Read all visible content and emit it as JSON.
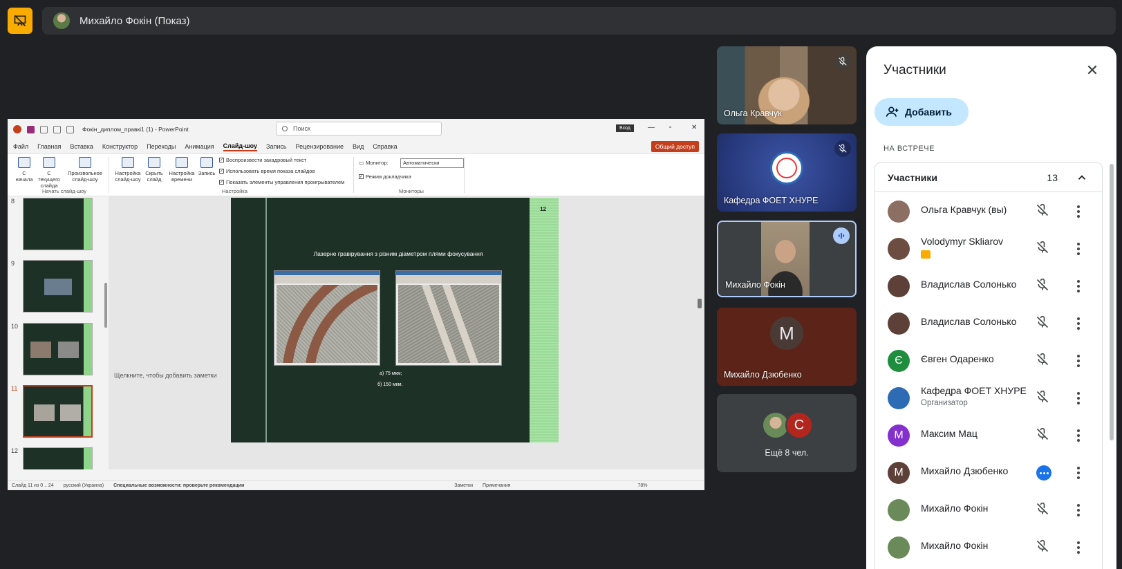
{
  "meeting": {
    "presenter_label": "Михайло Фокін (Показ)",
    "present_icon": "presentation-off-icon",
    "accent": "#f9ab00"
  },
  "powerpoint": {
    "filename": "Фокін_диплом_правкі1 (1)  -  PowerPoint",
    "search_placeholder": "Поиск",
    "login": "Вход",
    "menu": [
      "Файл",
      "Главная",
      "Вставка",
      "Конструктор",
      "Переходы",
      "Анимация",
      "Слайд-шоу",
      "Запись",
      "Рецензирование",
      "Вид",
      "Справка"
    ],
    "share": "Общий доступ",
    "ribbon": {
      "from_start": "С начала",
      "from_current": "С текущего слайда",
      "custom": "Произвольное слайд-шоу",
      "group_start": "Начать слайд-шоу",
      "setup": "Настройка слайд-шоу",
      "hide": "Скрыть слайд",
      "timing": "Настройка времени",
      "record": "Запись",
      "cb1": "Воспроизвести закадровый текст",
      "cb2": "Использовать время показа слайдов",
      "cb3": "Показать элементы управления проигрывателем",
      "group_setup": "Настройка",
      "monitor_label": "Монитор:",
      "monitor_value": "Автоматически",
      "presenter_view": "Режим докладчика",
      "group_monitors": "Мониторы"
    },
    "thumbnails": [
      {
        "num": "8"
      },
      {
        "num": "9"
      },
      {
        "num": "10"
      },
      {
        "num": "11"
      },
      {
        "num": "12"
      }
    ],
    "slide": {
      "number": "12",
      "title": "Лазерне гравірування з різним діаметром плями фокусування",
      "caption_a": "а) 75 мкм;",
      "caption_b": "б) 150 мкм."
    },
    "notes_placeholder": "Щелкните, чтобы добавить заметки",
    "status": {
      "slide": "Слайд 11 из 0 .. 24",
      "language": "русский (Украина)",
      "accessibility": "Специальные возможности: проверьте рекомендации",
      "notes": "Заметки",
      "comments": "Примечания",
      "zoom": "78%"
    }
  },
  "tiles": [
    {
      "name": "Ольга Кравчук",
      "muted": true
    },
    {
      "name": "Кафедра ФОЕТ ХНУРЕ",
      "muted": true
    },
    {
      "name": "Михайло Фокін",
      "muted": false
    },
    {
      "name": "Михайло Дзюбенко",
      "initial": "M"
    },
    {
      "more": "Ещё 8 чел.",
      "initial": "C"
    }
  ],
  "participants_panel": {
    "title": "Участники",
    "add": "Добавить",
    "section": "НА ВСТРЕЧЕ",
    "group_label": "Участники",
    "count": "13",
    "people": [
      {
        "name": "Ольга Кравчук (вы)",
        "av_color": "#8d6e63"
      },
      {
        "name": "Volodymyr Skliarov",
        "badge": "presenting",
        "av_color": "#6d4c41"
      },
      {
        "name": "Владислав Солонько",
        "av_color": "#5d4037"
      },
      {
        "name": "Владислав Солонько",
        "av_color": "#5d4037"
      },
      {
        "name": "Євген Одаренко",
        "initial": "Є",
        "av_color": "#1e8e3e"
      },
      {
        "name": "Кафедра ФОЕТ ХНУРЕ",
        "sub": "Организатор",
        "av_color": "#2d6bb5"
      },
      {
        "name": "Максим Мац",
        "initial": "M",
        "av_color": "#8430ce"
      },
      {
        "name": "Михайло Дзюбенко",
        "initial": "M",
        "av_color": "#5d4037",
        "speaking": true
      },
      {
        "name": "Михайло Фокін",
        "av_color": "#6b8a5a"
      },
      {
        "name": "Михайло Фокін",
        "av_color": "#6b8a5a"
      }
    ]
  }
}
